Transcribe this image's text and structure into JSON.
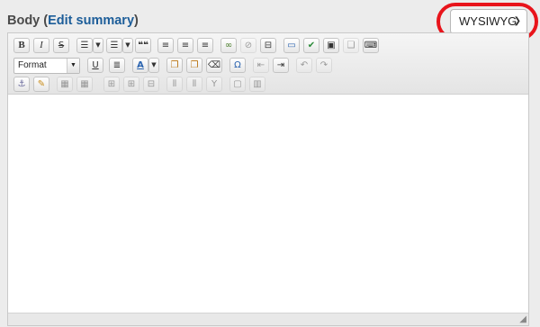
{
  "field": {
    "label_prefix": "Body (",
    "link": "Edit summary",
    "label_suffix": ")"
  },
  "text_format": {
    "selected": "WYSIWYG"
  },
  "toolbar": {
    "format_combo": "Format"
  },
  "icons": {
    "bold": "B",
    "italic": "I",
    "strike": "S",
    "blockquote": "❝❝",
    "underline": "U",
    "text_color": "A",
    "special_char": "Ω",
    "anchor": "⚓"
  },
  "colors": {
    "highlight": "#e8141b",
    "link": "#1c5d99"
  }
}
